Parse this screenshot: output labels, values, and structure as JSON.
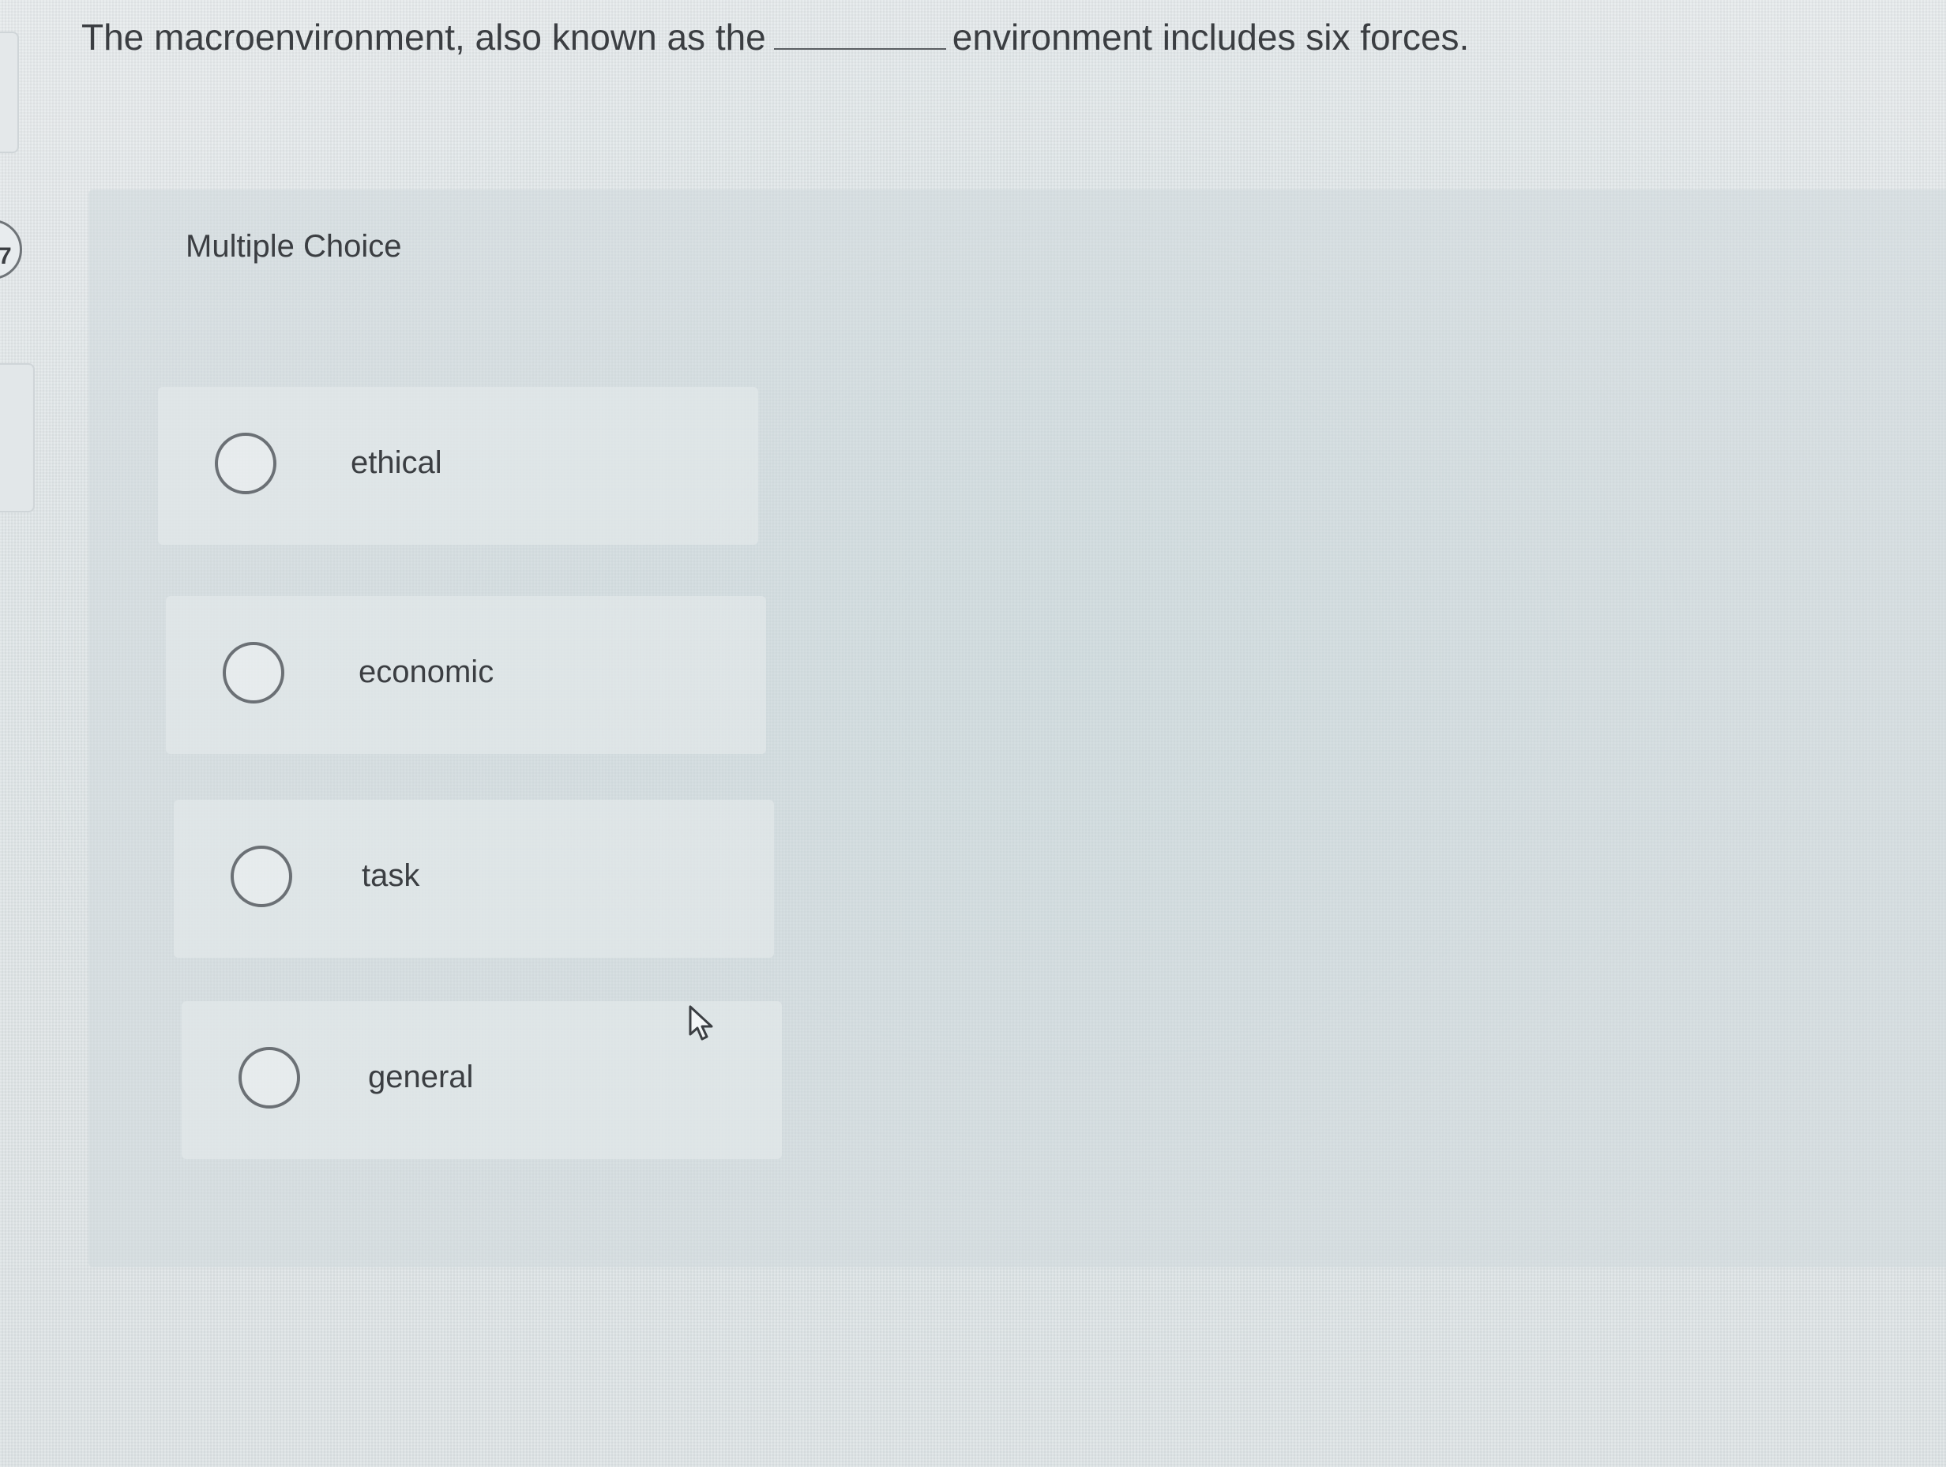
{
  "question": {
    "text_before": "The macroenvironment, also known as the",
    "blank": "",
    "text_after": "environment includes six forces."
  },
  "question_number": "7",
  "section_label": "Multiple Choice",
  "options": [
    {
      "label": "ethical",
      "selected": false
    },
    {
      "label": "economic",
      "selected": false
    },
    {
      "label": "task",
      "selected": false
    },
    {
      "label": "general",
      "selected": false
    }
  ],
  "icons": {
    "radio": "radio-unselected-icon",
    "cursor": "mouse-pointer-icon"
  },
  "colors": {
    "text": "#3b3e42",
    "radio_border": "#6b7075",
    "panel": "#d0d8dc"
  }
}
